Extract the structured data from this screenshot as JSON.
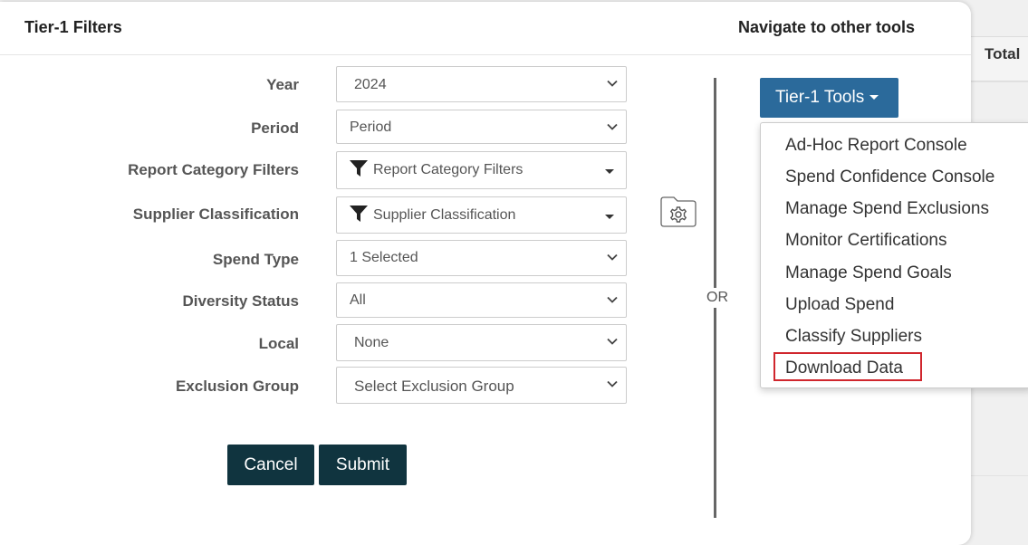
{
  "background": {
    "table_header": "Total"
  },
  "modal": {
    "title": "Tier-1 Filters",
    "nav_title": "Navigate to other tools"
  },
  "filters": [
    {
      "label": "Year",
      "value": "2024",
      "control": "select"
    },
    {
      "label": "Period",
      "value": "Period",
      "control": "select"
    },
    {
      "label": "Report Category Filters",
      "value": "Report Category Filters",
      "control": "multiselect"
    },
    {
      "label": "Supplier Classification",
      "value": "Supplier Classification",
      "control": "multiselect"
    },
    {
      "label": "Spend Type",
      "value": "1 Selected",
      "control": "select"
    },
    {
      "label": "Diversity Status",
      "value": "All",
      "control": "select"
    },
    {
      "label": "Local",
      "value": "None",
      "control": "select"
    },
    {
      "label": "Exclusion Group",
      "value": "Select Exclusion Group",
      "control": "select"
    }
  ],
  "buttons": {
    "cancel": "Cancel",
    "submit": "Submit"
  },
  "separator": "OR",
  "tools": {
    "button_label": "Tier-1 Tools",
    "items": [
      "Ad-Hoc Report Console",
      "Spend Confidence Console",
      "Manage Spend Exclusions",
      "Monitor Certifications",
      "Manage Spend Goals",
      "Upload Spend",
      "Classify Suppliers",
      "Download Data"
    ]
  },
  "icons": {
    "select_arrow": "chevron-down-icon",
    "multiselect_icon": "filter-funnel-icon",
    "settings": "folder-gear-icon"
  },
  "colors": {
    "primary_dark": "#10343f",
    "tools_blue": "#2b6a9b",
    "highlight_red": "#d0262d"
  }
}
